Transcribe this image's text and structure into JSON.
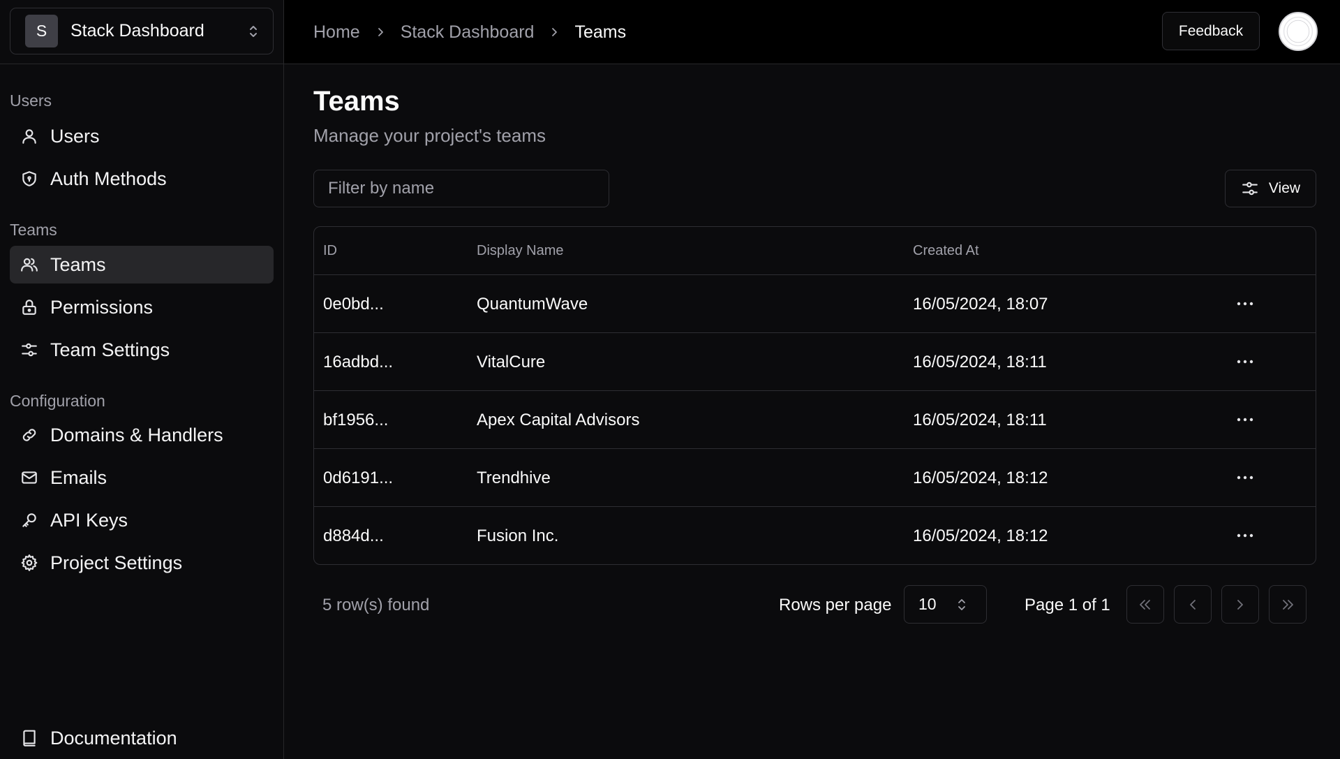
{
  "project_switcher": {
    "initial": "S",
    "name": "Stack Dashboard"
  },
  "topbar": {
    "breadcrumbs": [
      "Home",
      "Stack Dashboard",
      "Teams"
    ],
    "feedback_label": "Feedback"
  },
  "sidebar": {
    "sections": [
      {
        "label": "Users",
        "items": [
          {
            "label": "Users",
            "icon": "user-icon"
          },
          {
            "label": "Auth Methods",
            "icon": "shield-icon"
          }
        ]
      },
      {
        "label": "Teams",
        "items": [
          {
            "label": "Teams",
            "icon": "users-icon",
            "active": true
          },
          {
            "label": "Permissions",
            "icon": "lock-icon"
          },
          {
            "label": "Team Settings",
            "icon": "settings-sliders-icon"
          }
        ]
      },
      {
        "label": "Configuration",
        "items": [
          {
            "label": "Domains & Handlers",
            "icon": "link-icon"
          },
          {
            "label": "Emails",
            "icon": "mail-icon"
          },
          {
            "label": "API Keys",
            "icon": "key-icon"
          },
          {
            "label": "Project Settings",
            "icon": "gear-icon"
          }
        ]
      }
    ],
    "footer": {
      "label": "Documentation",
      "icon": "book-icon"
    }
  },
  "page": {
    "title": "Teams",
    "subtitle": "Manage your project's teams",
    "filter_placeholder": "Filter by name",
    "view_label": "View"
  },
  "table": {
    "columns": [
      "ID",
      "Display Name",
      "Created At"
    ],
    "rows": [
      {
        "id": "0e0bd...",
        "name": "QuantumWave",
        "created": "16/05/2024, 18:07"
      },
      {
        "id": "16adbd...",
        "name": "VitalCure",
        "created": "16/05/2024, 18:11"
      },
      {
        "id": "bf1956...",
        "name": "Apex Capital Advisors",
        "created": "16/05/2024, 18:11"
      },
      {
        "id": "0d6191...",
        "name": "Trendhive",
        "created": "16/05/2024, 18:12"
      },
      {
        "id": "d884d...",
        "name": "Fusion Inc.",
        "created": "16/05/2024, 18:12"
      }
    ]
  },
  "pagination": {
    "rows_found": "5 row(s) found",
    "rows_per_page_label": "Rows per page",
    "rows_per_page_value": "10",
    "page_info": "Page 1 of 1"
  },
  "colors": {
    "background": "#0b0b0d",
    "topbar": "#000000",
    "border": "#27272a",
    "active_item": "#27272a",
    "text": "#fafafa",
    "muted_text": "#a1a1aa"
  }
}
